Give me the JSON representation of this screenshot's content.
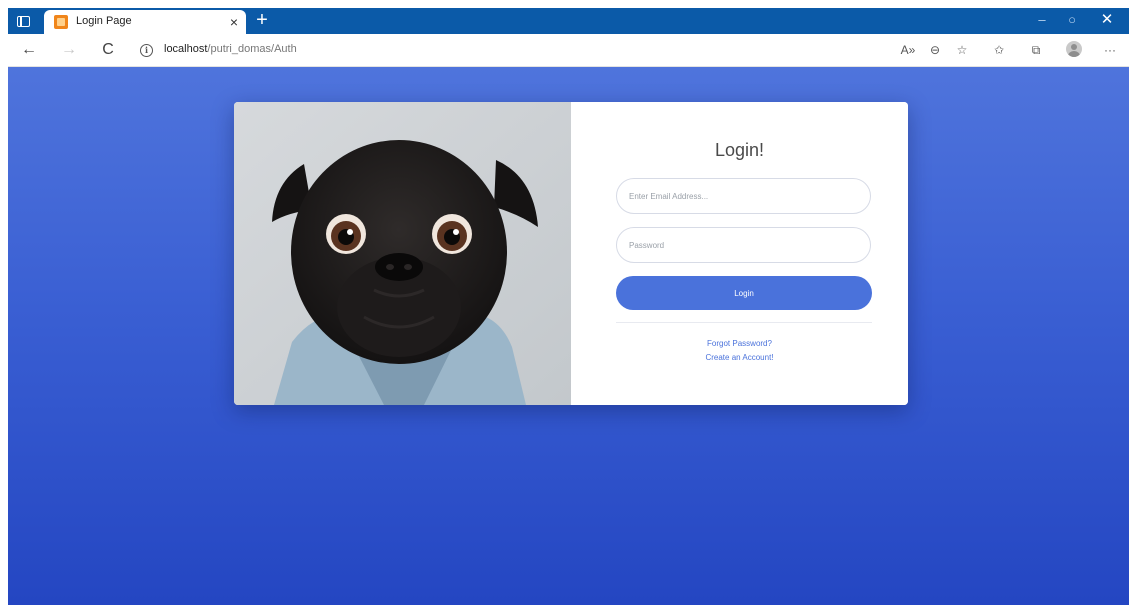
{
  "browser": {
    "tab": {
      "title": "Login Page",
      "close": "×"
    },
    "new_tab": "+",
    "window_controls": {
      "minimize": "–",
      "maximize": "○",
      "close": "✕"
    },
    "nav": {
      "back": "←",
      "forward": "→",
      "reload": "C"
    },
    "address": {
      "info": "i",
      "host": "localhost",
      "path": "/putri_domas/Auth"
    },
    "toolbar_icons": {
      "read_aloud": "A»",
      "zoom": "⊖",
      "add_favorite": "☆",
      "favorites": "✩",
      "collections": "⧉",
      "more": "···"
    }
  },
  "login": {
    "title": "Login!",
    "email_placeholder": "Enter Email Address...",
    "password_placeholder": "Password",
    "submit_label": "Login",
    "forgot_password": "Forgot Password?",
    "create_account": "Create an Account!"
  },
  "colors": {
    "browser_chrome": "#0b5aa8",
    "page_gradient_top": "#4f74dc",
    "page_gradient_bottom": "#2446c2",
    "primary": "#4a72db",
    "title_text": "#4a4a4a"
  }
}
